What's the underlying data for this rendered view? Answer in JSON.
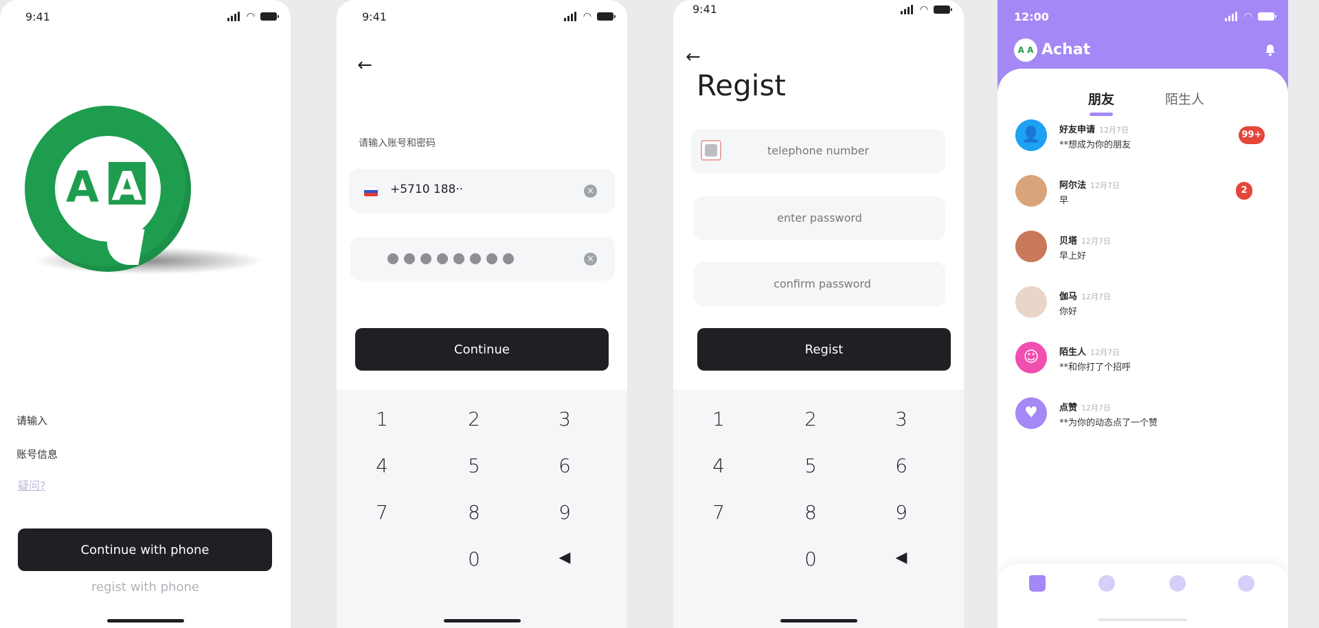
{
  "screen1": {
    "time": "9:41",
    "logo_letters": [
      "A",
      "A"
    ],
    "line1": "请输入",
    "line2": "账号信息",
    "link": "疑问?",
    "primary_button": "Continue with phone",
    "secondary_link": "regist with phone"
  },
  "screen2": {
    "time": "9:41",
    "hint": "请输入账号和密码",
    "phone_value": "+5710  188··",
    "password_dots": 8,
    "continue_button": "Continue",
    "keys": [
      "1",
      "2",
      "3",
      "4",
      "5",
      "6",
      "7",
      "8",
      "9",
      "0"
    ]
  },
  "screen3": {
    "time": "9:41",
    "title": "Regist",
    "phone_placeholder": "telephone number",
    "password_placeholder": "enter password",
    "confirm_placeholder": "confirm password",
    "regist_button": "Regist",
    "keys": [
      "1",
      "2",
      "3",
      "4",
      "5",
      "6",
      "7",
      "8",
      "9",
      "0"
    ]
  },
  "screen4": {
    "time": "12:00",
    "logo_text": "A A",
    "app_name": "Achat",
    "tabs": [
      "朋友",
      "陌生人"
    ],
    "chats": [
      {
        "name": "好友申请",
        "date": "12月7日",
        "message": "**想成为你的朋友",
        "badge": "99+",
        "avatar_color": "#1da1f2",
        "avatar_icon": "user-add-icon"
      },
      {
        "name": "阿尔法",
        "date": "12月7日",
        "message": "早",
        "badge": "2",
        "avatar_color": "#d9a47a",
        "avatar_icon": "photo-avatar"
      },
      {
        "name": "贝塔",
        "date": "12月7日",
        "message": "早上好",
        "badge": "",
        "avatar_color": "#c9785a",
        "avatar_icon": "photo-avatar"
      },
      {
        "name": "伽马",
        "date": "12月7日",
        "message": "你好",
        "badge": "",
        "avatar_color": "#e9d6c9",
        "avatar_icon": "photo-avatar"
      },
      {
        "name": "陌生人",
        "date": "12月7日",
        "message": "**和你打了个招呼",
        "badge": "",
        "avatar_color": "#f14fb0",
        "avatar_icon": "smile-icon"
      },
      {
        "name": "点赞",
        "date": "12月7日",
        "message": "**为你的动态点了一个赞",
        "badge": "",
        "avatar_color": "#a388f6",
        "avatar_icon": "heart-icon"
      }
    ],
    "nav_icons": [
      "home-icon",
      "discover-icon",
      "chat-icon",
      "profile-icon"
    ],
    "accent_color": "#a388f6"
  }
}
